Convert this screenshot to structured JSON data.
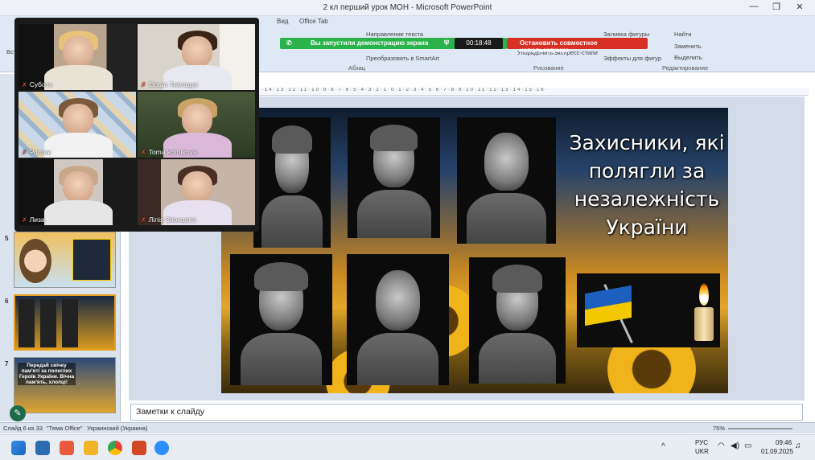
{
  "window": {
    "title": "2 кл перший урок МОН  -  Microsoft PowerPoint",
    "min": "—",
    "max": "❐",
    "close": "✕"
  },
  "ribbon": {
    "tabs": [
      "Вид",
      "Office Tab"
    ],
    "groups": [
      "Абзац",
      "Рисование",
      "Редактирование"
    ],
    "items": {
      "direction": "Направление текста",
      "convert": "Преобразовать в SmartArt",
      "fill": "Заливка фигуры",
      "effects": "Эффекты для фигур",
      "arrange": "Упорядочить",
      "styles": "Экспресс-стили",
      "find": "Найти",
      "replace": "Заменить",
      "select": "Выделить",
      "paste": "Вста"
    }
  },
  "share": {
    "message": "Вы запустили демонстрацию экрана",
    "timer": "00:18:48",
    "stop": "Остановить совместное использование"
  },
  "ruler": "·14·13·12·11·10·9·8·7·6·5·4·3·2·1·0·1·2·3·4·5·6·7·8·9·10·11·12·13·14·15·16·",
  "sidebar": {
    "slides": [
      {
        "n": "5"
      },
      {
        "n": "6"
      },
      {
        "n": "7",
        "text": "Передай свічку пам'яті за полеглих Героїв України. Вічна пам'ять, хлопці!"
      }
    ]
  },
  "slide": {
    "title": "Захисники, які полягли за незалежність України"
  },
  "notes": "Заметки к слайду",
  "status": {
    "slide": "Слайд 6 из 33",
    "theme": "\"Тема Office\"",
    "lang": "Украинский (Украина)",
    "zoom": "75%"
  },
  "tray": {
    "lang1": "РУС",
    "lang2": "UKR",
    "time": "09:46",
    "date": "01.09.2025"
  },
  "participants": [
    {
      "name": "Субота",
      "active": false
    },
    {
      "name": "Ольга Тимощук",
      "active": false
    },
    {
      "name": "Ростик",
      "active": true
    },
    {
      "name": "Toma korotkova",
      "active": false
    },
    {
      "name": "Лиза",
      "active": false
    },
    {
      "name": "Лілія Звонцова",
      "active": false
    }
  ],
  "colors": {
    "share_green": "#2ab34a",
    "stop_red": "#d93025",
    "active_tile": "#2ecc71",
    "flag_blue": "#1c5fbf",
    "flag_yellow": "#f3c800"
  },
  "icons": [
    "mic-muted-icon",
    "windows-start-icon",
    "taskbar-app-icon",
    "wifi-icon",
    "volume-icon",
    "battery-icon",
    "bell-icon",
    "pen-icon"
  ]
}
